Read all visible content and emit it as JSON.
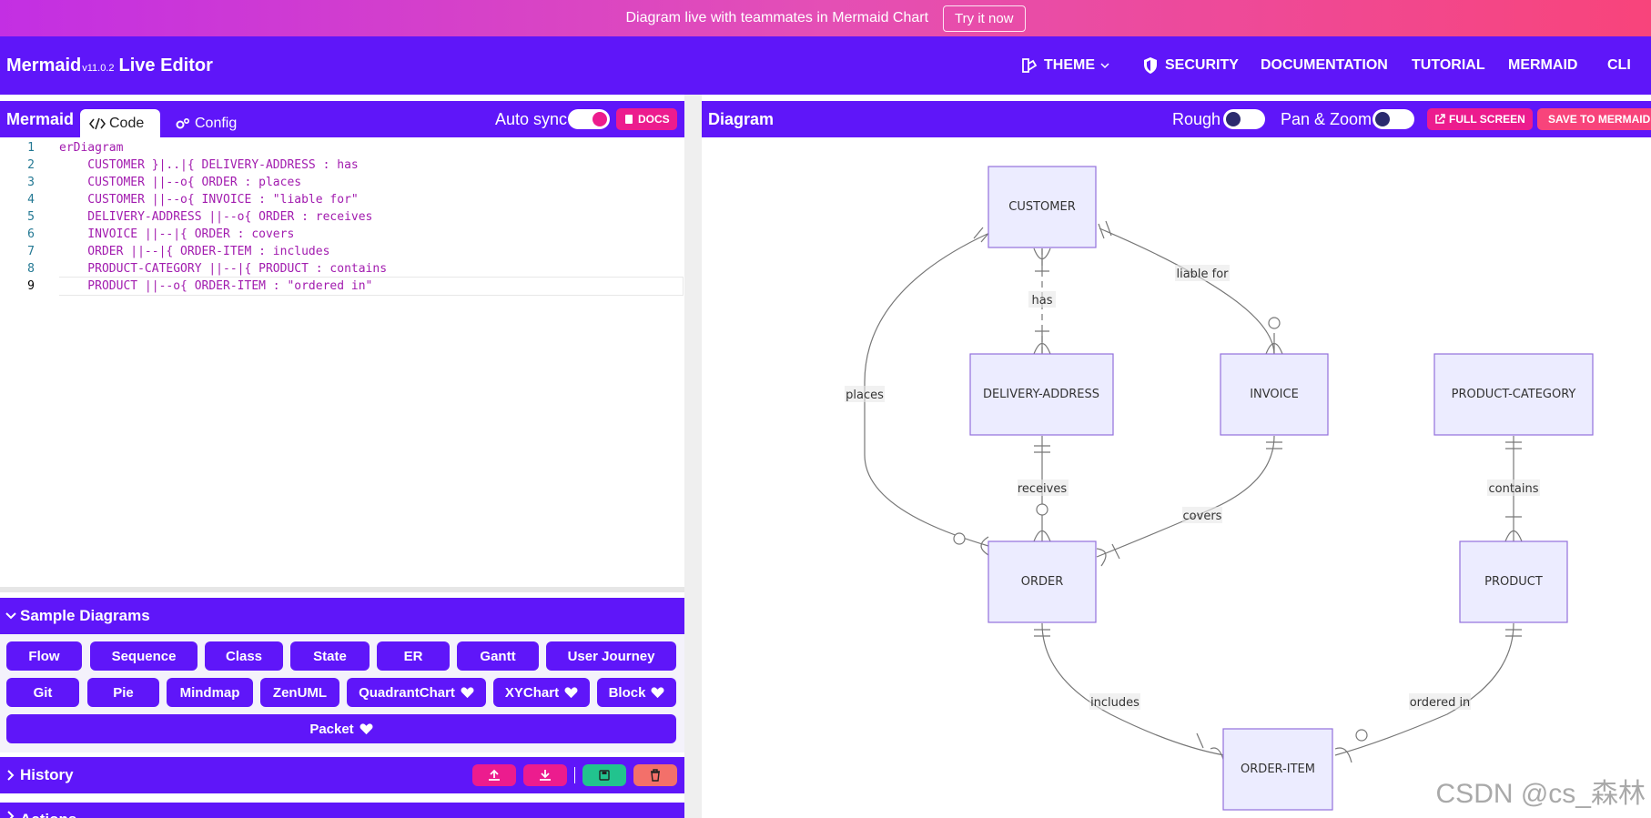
{
  "banner": {
    "text": "Diagram live with teammates in Mermaid Chart",
    "button": "Try it now"
  },
  "header": {
    "brand": "Mermaid",
    "version": "v11.0.2",
    "suffix": "Live Editor",
    "nav": [
      {
        "label": "THEME",
        "icon": "theme-icon"
      },
      {
        "label": "SECURITY",
        "icon": "shield-icon"
      },
      {
        "label": "DOCUMENTATION"
      },
      {
        "label": "TUTORIAL"
      },
      {
        "label": "MERMAID"
      },
      {
        "label": "CLI"
      }
    ]
  },
  "editor": {
    "title": "Mermaid",
    "tabs": [
      {
        "label": "Code",
        "icon": "code-icon"
      },
      {
        "label": "Config",
        "icon": "gear-icon"
      }
    ],
    "auto_sync_label": "Auto sync",
    "docs_label": "DOCS",
    "lines": [
      "erDiagram",
      "    CUSTOMER }|..|{ DELIVERY-ADDRESS : has",
      "    CUSTOMER ||--o{ ORDER : places",
      "    CUSTOMER ||--o{ INVOICE : \"liable for\"",
      "    DELIVERY-ADDRESS ||--o{ ORDER : receives",
      "    INVOICE ||--|{ ORDER : covers",
      "    ORDER ||--|{ ORDER-ITEM : includes",
      "    PRODUCT-CATEGORY ||--|{ PRODUCT : contains",
      "    PRODUCT ||--o{ ORDER-ITEM : \"ordered in\""
    ],
    "line_numbers": [
      "1",
      "2",
      "3",
      "4",
      "5",
      "6",
      "7",
      "8",
      "9"
    ]
  },
  "samples": {
    "title": "Sample Diagrams",
    "buttons": [
      "Flow",
      "Sequence",
      "Class",
      "State",
      "ER",
      "Gantt",
      "User Journey",
      "Git",
      "Pie",
      "Mindmap",
      "ZenUML",
      "QuadrantChart",
      "XYChart",
      "Block",
      "Packet"
    ]
  },
  "history": {
    "title": "History"
  },
  "actions": {
    "title": "Actions"
  },
  "diagram_panel": {
    "title": "Diagram",
    "rough_label": "Rough",
    "panzoom_label": "Pan & Zoom",
    "fullscreen_label": "FULL SCREEN",
    "save_label": "SAVE TO MERMAID"
  },
  "er": {
    "entities": [
      "CUSTOMER",
      "DELIVERY-ADDRESS",
      "INVOICE",
      "PRODUCT-CATEGORY",
      "ORDER",
      "PRODUCT",
      "ORDER-ITEM"
    ],
    "relationships": [
      "has",
      "liable for",
      "places",
      "receives",
      "covers",
      "contains",
      "includes",
      "ordered in"
    ]
  },
  "watermark": "CSDN @cs_森林",
  "colors": {
    "primary": "#5f16f9",
    "pink": "#ec1c8e",
    "green": "#22c38e",
    "red": "#f3706a",
    "entity_fill": "#ececff",
    "entity_stroke": "#9370db"
  }
}
